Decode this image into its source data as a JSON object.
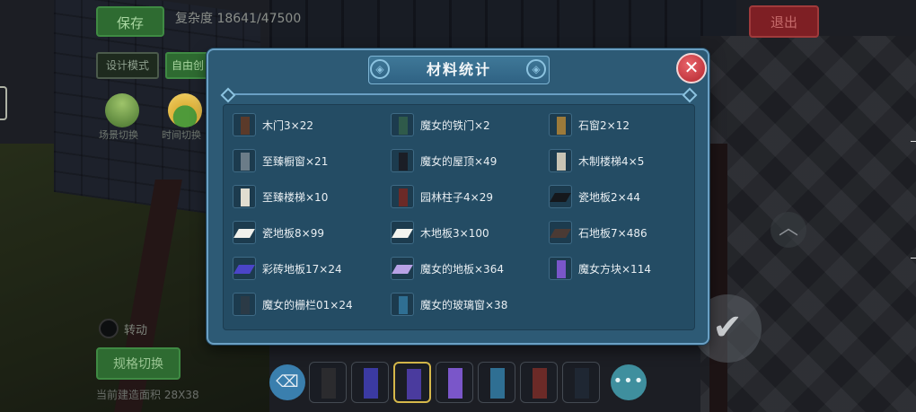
{
  "hud": {
    "save_label": "保存",
    "complexity_text": "复杂度 18641/47500",
    "exit_label": "退出",
    "mode_design_label": "设计模式",
    "mode_free_label": "自由创",
    "scene_switch_label": "场景切换",
    "time_switch_label": "时间切换",
    "rotate_label": "转动",
    "spec_switch_label": "规格切换",
    "build_area_text": "当前建造面积 28X38"
  },
  "modal": {
    "title": "材料统计",
    "close_glyph": "✕",
    "materials": [
      {
        "label": "木门3×22",
        "icon": "wood-door-icon",
        "color": "#5b3a2a"
      },
      {
        "label": "魔女的铁门×2",
        "icon": "iron-gate-icon",
        "color": "#2f5a4a"
      },
      {
        "label": "石窗2×12",
        "icon": "stone-window-icon",
        "color": "#9c7a3a"
      },
      {
        "label": "至臻橱窗×21",
        "icon": "display-window-icon",
        "color": "#6b7c88"
      },
      {
        "label": "魔女的屋顶×49",
        "icon": "witch-roof-icon",
        "color": "#1b1e26"
      },
      {
        "label": "木制楼梯4×5",
        "icon": "wood-stairs-icon",
        "color": "#c9c4b4"
      },
      {
        "label": "至臻楼梯×10",
        "icon": "stairs-icon",
        "color": "#e1ddd0"
      },
      {
        "label": "园林柱子4×29",
        "icon": "garden-pillar-icon",
        "color": "#6b2a27"
      },
      {
        "label": "瓷地板2×44",
        "icon": "tile-floor-black-icon",
        "color": "#15181c"
      },
      {
        "label": "瓷地板8×99",
        "icon": "tile-floor-white-icon",
        "color": "#f1f1ec"
      },
      {
        "label": "木地板3×100",
        "icon": "wood-floor-icon",
        "color": "#f4f4ef"
      },
      {
        "label": "石地板7×486",
        "icon": "stone-floor-icon",
        "color": "#4b3a34"
      },
      {
        "label": "彩砖地板17×24",
        "icon": "colored-tile-floor-icon",
        "color": "#4b45c8"
      },
      {
        "label": "魔女的地板×364",
        "icon": "witch-floor-icon",
        "color": "#b8a2e6"
      },
      {
        "label": "魔女方块×114",
        "icon": "witch-block-icon",
        "color": "#7a56c9"
      },
      {
        "label": "魔女的栅栏01×24",
        "icon": "witch-fence-icon",
        "color": "#2b3a46"
      },
      {
        "label": "魔女的玻璃窗×38",
        "icon": "witch-glass-window-icon",
        "color": "#2f6f93"
      }
    ]
  },
  "hotbar": {
    "eraser_icon": "eraser-icon",
    "more_glyph": "•••",
    "slots": [
      {
        "name": "slot-dark-pillar",
        "color": "#2b2b2e"
      },
      {
        "name": "slot-blue-pillar",
        "color": "#3b3aa2"
      },
      {
        "name": "slot-purple-pillar",
        "color": "#4a3b9e"
      },
      {
        "name": "slot-witch-block",
        "color": "#7a56c9"
      },
      {
        "name": "slot-glass-window",
        "color": "#2f6f93"
      },
      {
        "name": "slot-red-pillar",
        "color": "#6b2a27"
      },
      {
        "name": "slot-fence",
        "color": "#1f2733"
      }
    ]
  }
}
